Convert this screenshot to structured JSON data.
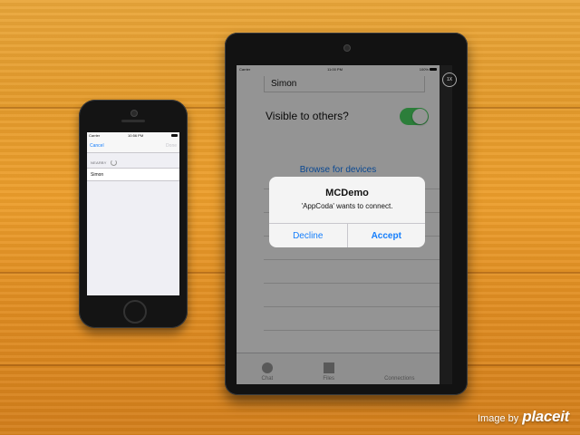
{
  "iphone": {
    "status": {
      "carrier": "Carrier",
      "time": "10:56 PM"
    },
    "nav": {
      "cancel_label": "Cancel",
      "done_label": "Done"
    },
    "section_header": "NEARBY",
    "peers": [
      {
        "name": "Simon"
      }
    ]
  },
  "ipad": {
    "status": {
      "carrier": "Carrier",
      "time": "11:00 PM",
      "battery": "100%"
    },
    "name_field_value": "Simon",
    "visible_label": "Visible to others?",
    "visible_on": true,
    "browse_label": "Browse for devices",
    "zoom_label": "1X",
    "tabs": [
      {
        "label": "Chat",
        "icon": "chat-circle-icon"
      },
      {
        "label": "Files",
        "icon": "files-square-icon"
      },
      {
        "label": "Connections",
        "icon": "connections-icon"
      }
    ],
    "alert": {
      "title": "MCDemo",
      "message": "'AppCoda' wants to connect.",
      "decline_label": "Decline",
      "accept_label": "Accept"
    }
  },
  "watermark": {
    "prefix": "Image by",
    "brand": "placeit"
  },
  "colors": {
    "accent": "#157efb",
    "toggle_on": "#4cd964"
  }
}
